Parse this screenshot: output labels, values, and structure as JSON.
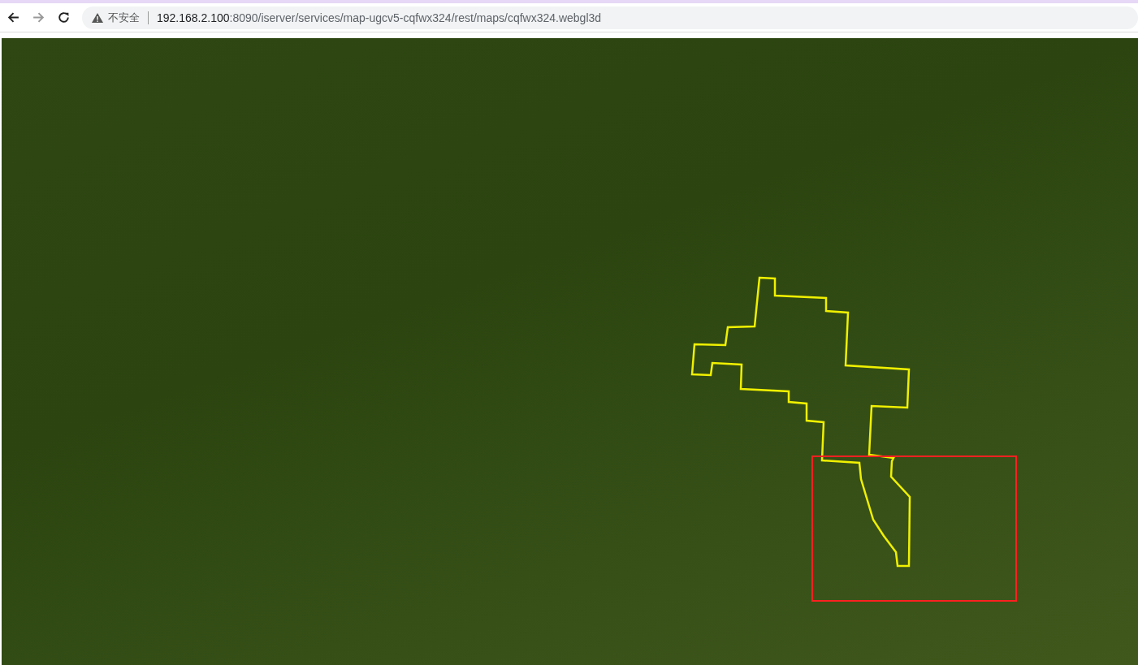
{
  "browser": {
    "security_label": "不安全",
    "url_host": "192.168.2.100",
    "url_path": ":8090/iserver/services/map-ugcv5-cqfwx324/rest/maps/cqfwx324.webgl3d"
  }
}
